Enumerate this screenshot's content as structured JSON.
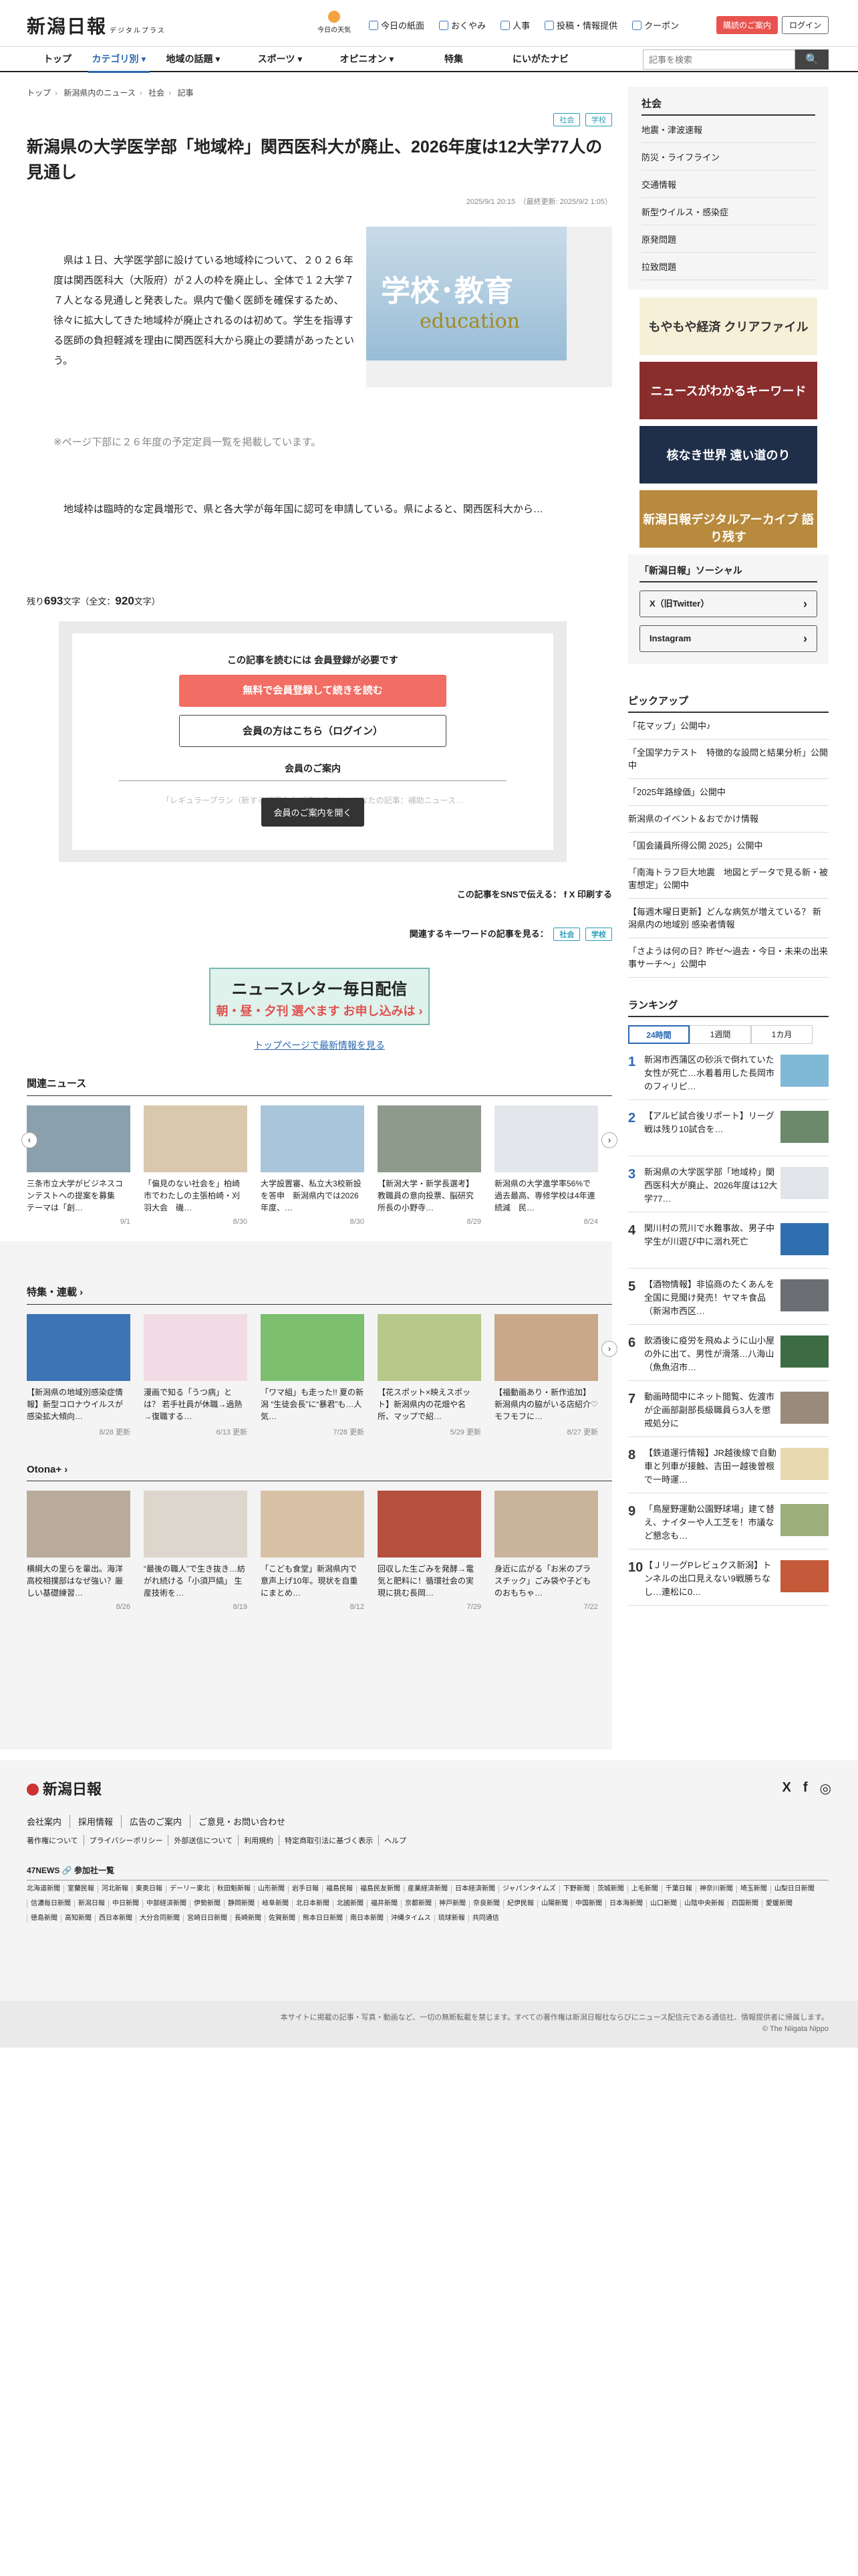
{
  "header": {
    "logo": "新潟日報",
    "logo_sub": "デジタルプラス",
    "weather": "今日の天気",
    "nav": [
      "今日の紙面",
      "おくやみ",
      "人事",
      "投稿・情報提供",
      "クーポン"
    ],
    "guide_btn": "購読のご案内",
    "login_btn": "ログイン"
  },
  "gnav": {
    "items": [
      "トップ",
      "カテゴリ別 ▾",
      "地域の話題 ▾",
      "スポーツ ▾",
      "オピニオン ▾",
      "特集",
      "にいがたナビ"
    ],
    "search_placeholder": "記事を検索",
    "search_icon": "🔍"
  },
  "breadcrumb": [
    "トップ",
    "新潟県内のニュース",
    "社会",
    "記事"
  ],
  "article": {
    "tags": [
      "社会",
      "学校"
    ],
    "headline": "新潟県の大学医学部「地域枠」関西医科大が廃止、2026年度は12大学77人の見通し",
    "dates": "2025/9/1 20:15　（最終更新: 2025/9/2 1:05）",
    "body1": "　県は１日、大学医学部に設けている地域枠について、２０２６年度は関西医科大（大阪府）が２人の枠を廃止し、全体で１２大学７７人となる見通しと発表した。県内で働く医師を確保するため、徐々に拡大してきた地域枠が廃止されるのは初めて。学生を指導する医師の負担軽減を理由に関西医科大から廃止の要請があったという。",
    "note": "※ページ下部に２６年度の予定定員一覧を掲載しています。",
    "body2": "　地域枠は臨時的な定員増形で、県と各大学が毎年国に認可を申請している。県によると、関西医科大から…",
    "hero_t1": "学校･教育",
    "hero_t2": "education",
    "count_pre": "残り",
    "count_num": "693",
    "count_mid": "文字（全文：",
    "count_total": "920",
    "count_post": "文字）"
  },
  "paywall": {
    "lead": "この記事を読むには 会員登録が必要です",
    "free_btn": "無料で会員登録して続きを読む",
    "login_btn": "会員の方はこちら（ログイン）",
    "sub": "会員のご案内",
    "fade": "「レギュラープラン（新する記事本文が読める…）」 あなたの記事：補助ニュース…",
    "open_btn": "会員のご案内を開く"
  },
  "share": {
    "label": "この記事をSNSで伝える：",
    "fb": "f",
    "x": "X",
    "print": "印刷する",
    "kw_label": "関連するキーワードの記事を見る："
  },
  "newsletter": {
    "a": "ニュースレター毎日配信",
    "b": "朝・昼・夕刊 選べます お申し込みは ›"
  },
  "toplink": "トップページで最新情報を見る",
  "related": {
    "title": "関連ニュース",
    "items": [
      {
        "cap": "三条市立大学がビジネスコンテストへの提案を募集　テーマは「創…",
        "date": "9/1"
      },
      {
        "cap": "「偏見のない社会を」柏崎市でわたしの主張柏崎・刈羽大会　磯…",
        "date": "8/30"
      },
      {
        "cap": "大学設置審、私立大3校新設を答申　新潟県内では2026年度、…",
        "date": "8/30"
      },
      {
        "cap": "【新潟大学・新学長選考】教職員の意向投票、脳研究所長の小野寺…",
        "date": "8/29"
      },
      {
        "cap": "新潟県の大学進学率56%で過去最高、専修学校は4年連続減　民…",
        "date": "8/24"
      }
    ]
  },
  "features": {
    "title": "特集・連載 ›",
    "items": [
      {
        "cap": "【新潟県の地域別感染症情報】新型コロナウイルスが感染拡大傾向…",
        "date": "8/28",
        "badge": "更新"
      },
      {
        "cap": "漫画で知る「うつ病」とは？ 若手社員が休職→過熱→復職する…",
        "date": "6/13",
        "badge": "更新"
      },
      {
        "cap": "「ワマ組」も走った!! 夏の新潟 “生徒会長”に“暴君”も…人気…",
        "date": "7/28",
        "badge": "更新"
      },
      {
        "cap": "【花スポット×映えスポット】新潟県内の花畑や名所、マップで紹…",
        "date": "5/29",
        "badge": "更新"
      },
      {
        "cap": "【福動画あり・新作追加】新潟県内の脇がいる店紹介♡モフモフに…",
        "date": "8/27",
        "badge": "更新"
      }
    ]
  },
  "otona": {
    "title": "Otona+ ›",
    "items": [
      {
        "cap": "横綱大の里らを輩出。海洋高校相撲部はなぜ強い？厳しい基礎練習…",
        "date": "8/26"
      },
      {
        "cap": "“最後の職人”で生き抜き…紡がれ続ける「小須戸縞」 生産技術を…",
        "date": "8/19"
      },
      {
        "cap": "「こども食堂」新潟県内で意声上げ10年。現状を自重にまとめ…",
        "date": "8/12"
      },
      {
        "cap": "回収した生ごみを発酵→電気と肥料に！循環社会の実現に挑む長岡…",
        "date": "7/29"
      },
      {
        "cap": "身近に広がる「お米のプラスチック」ごみ袋や子どものおもちゃ…",
        "date": "7/22"
      }
    ]
  },
  "aside": {
    "society_title": "社会",
    "society_items": [
      "地震・津波速報",
      "防災・ライフライン",
      "交通情報",
      "新型ウイルス・感染症",
      "原発問題",
      "拉致問題"
    ],
    "banners": [
      "もやもや経済 クリアファイル",
      "ニュースがわかるキーワード",
      "核なき世界 遠い道のり",
      "新潟日報デジタルアーカイブ 語り残す"
    ],
    "social_title": "「新潟日報」ソーシャル",
    "social_x": "X（旧Twitter）",
    "social_ig": "Instagram",
    "pickup_title": "ピックアップ",
    "pickup": [
      "「花マップ」公開中♪",
      "「全国学力テスト　特徴的な設問と結果分析」公開中",
      "「2025年路線価」公開中",
      "新潟県のイベント＆おでかけ情報",
      "「国会議員所得公開 2025」公開中",
      "「南海トラフ巨大地震　地図とデータで見る新・被害想定」公開中",
      "【毎週木曜日更新】どんな病気が増えている？ 新潟県内の地域別 感染者情報",
      "「さようは何の日？昨ゼ〜過去・今日・未来の出来事サーチ〜」公開中"
    ],
    "ranking_title": "ランキング",
    "ranking_tabs": [
      "24時間",
      "1週間",
      "1カ月"
    ],
    "ranking": [
      "新潟市西蒲区の砂浜で倒れていた女性が死亡…水着着用した長岡市のフィリピ…",
      "【アルビ試合後リポート】リーグ戦は残り10試合を…",
      "新潟県の大学医学部「地域枠」関西医科大が廃止、2026年度は12大学77…",
      "関川村の荒川で水難事故、男子中学生が川遊び中に溺れ死亡",
      "【酒物情報】非協商のたくあんを全国に見聞け発売！ヤマキ食品（新潟市西区…",
      "飲酒後に疫労を飛ぬように山小屋の外に出て、男性が滑落…八海山（魚魚沼市…",
      "動画時間中にネット閲覧、佐渡市が企画部副部長級職員ら3人を懲戒処分に",
      "【鉄道運行情報】JR越後線で自動車と列車が接触、吉田ー越後曽根で一時運…",
      "「鳥屋野運動公園野球場」建て替え、ナイターや人工芝を！市議など懇念も…",
      "【ＪリーグPレビュクス新潟】トンネルの出口見えない9戦勝ちなし…連松に0…"
    ]
  },
  "footer": {
    "logo": "新潟日報",
    "icons": [
      "X",
      "f",
      "◎"
    ],
    "links": [
      "会社案内",
      "採用情報",
      "広告のご案内",
      "ご意見・お問い合わせ"
    ],
    "links2": [
      "著作権について",
      "プライバシーポリシー",
      "外部送信について",
      "利用規約",
      "特定商取引法に基づく表示",
      "ヘルプ"
    ],
    "news47": "47NEWS 🔗 参加社一覧",
    "papers": [
      "北海道新聞",
      "室蘭民報",
      "河北新報",
      "東奥日報",
      "デーリー東北",
      "秋田魁新報",
      "山形新聞",
      "岩手日報",
      "福島民報",
      "福島民友新聞",
      "産業経済新聞",
      "日本経済新聞",
      "ジャパンタイムズ",
      "下野新聞",
      "茨城新聞",
      "上毛新聞",
      "千葉日報",
      "神奈川新聞",
      "埼玉新聞",
      "山梨日日新聞",
      "信濃毎日新聞",
      "新潟日報",
      "中日新聞",
      "中部経済新聞",
      "伊勢新聞",
      "静岡新聞",
      "岐阜新聞",
      "北日本新聞",
      "北國新聞",
      "福井新聞",
      "京都新聞",
      "神戸新聞",
      "奈良新聞",
      "紀伊民報",
      "山陽新聞",
      "中国新聞",
      "日本海新聞",
      "山口新聞",
      "山陰中央新報",
      "四国新聞",
      "愛媛新聞",
      "徳島新聞",
      "高知新聞",
      "西日本新聞",
      "大分合同新聞",
      "宮崎日日新聞",
      "長崎新聞",
      "佐賀新聞",
      "熊本日日新聞",
      "南日本新聞",
      "沖縄タイムス",
      "琉球新報",
      "共同通信"
    ],
    "copy1": "本サイトに掲載の記事・写真・動画など、一切の無断転載を禁じます。すべての著作権は新潟日報社ならびにニュース配信元である通信社、情報提供者に帰属します。",
    "copy2": "© The Niigata Nippo"
  }
}
